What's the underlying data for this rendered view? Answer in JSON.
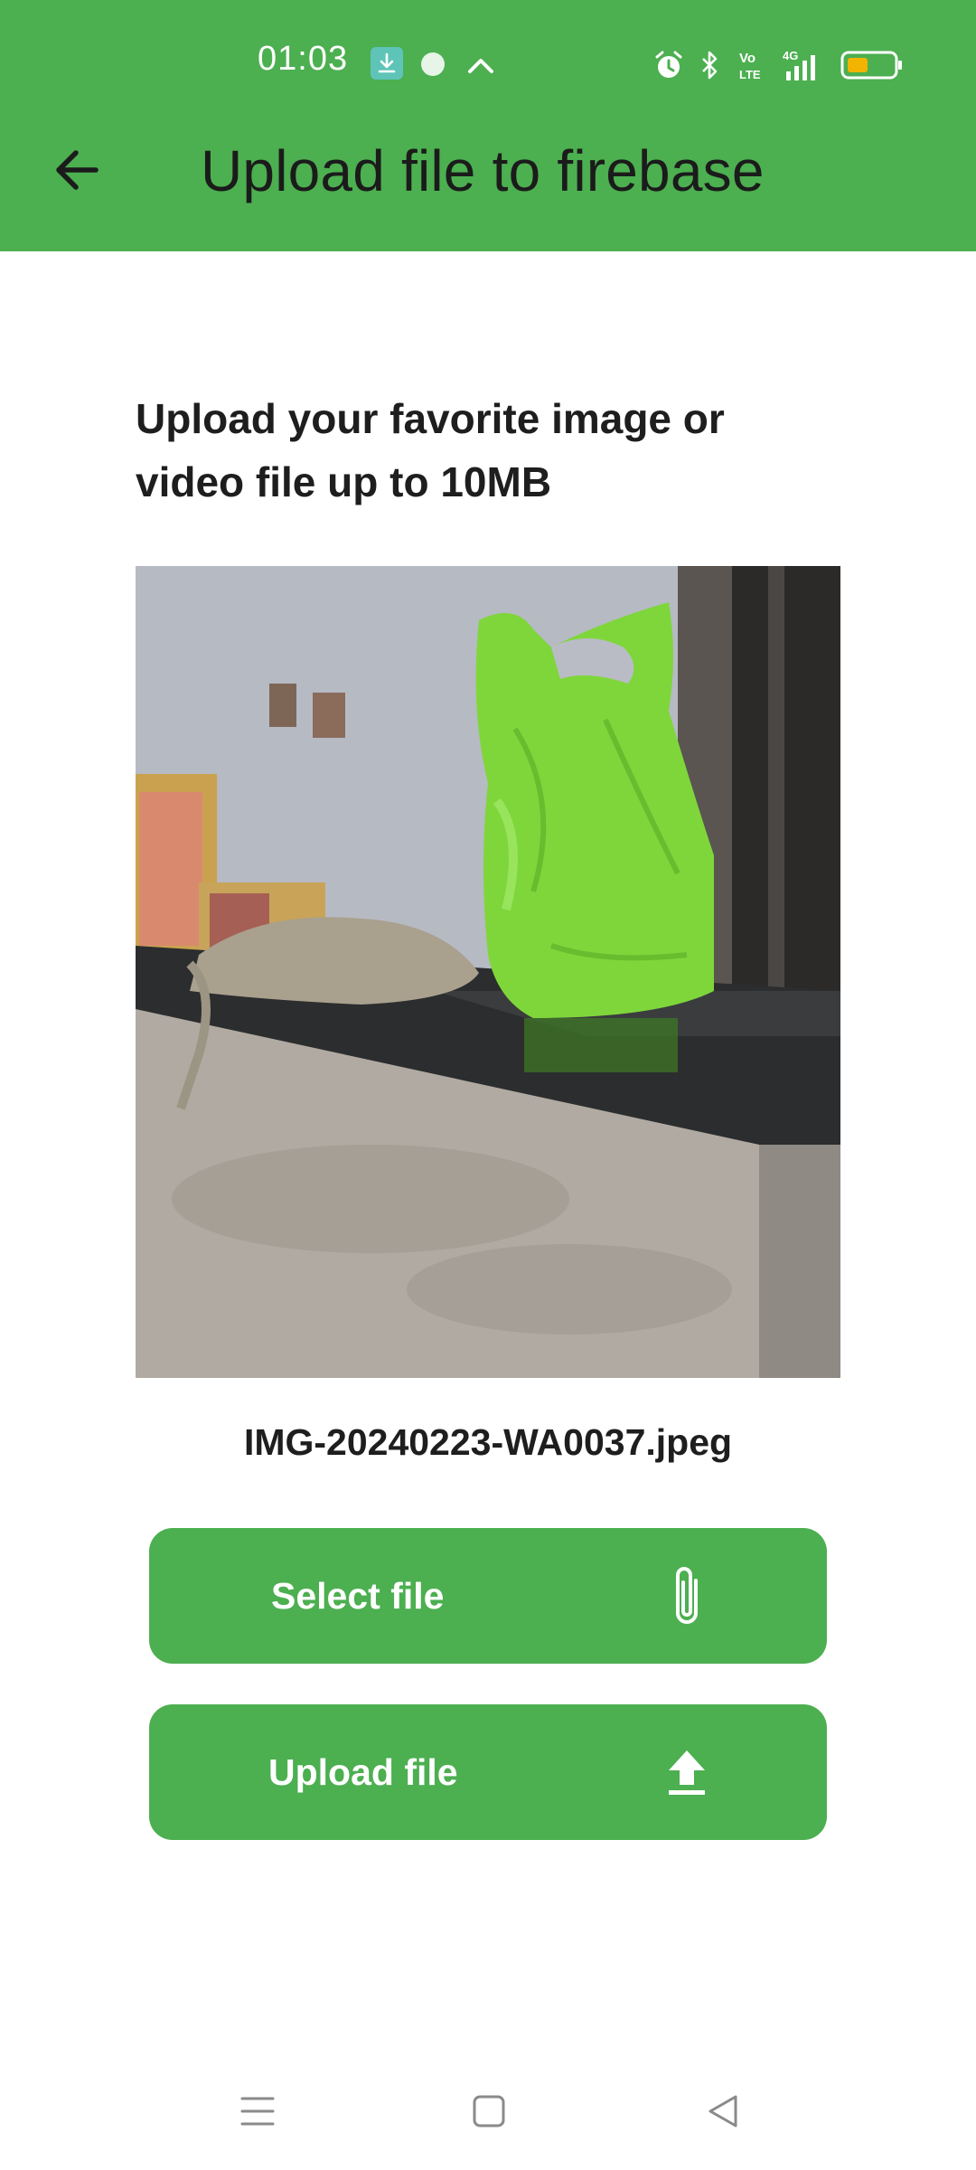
{
  "status_bar": {
    "time": "01:03",
    "icons": [
      "download-icon",
      "app-notification-icon",
      "chevron-up-icon",
      "alarm-icon",
      "bluetooth-icon",
      "volte-icon",
      "signal-4g-icon",
      "battery-icon"
    ],
    "battery_color": "#f2b400"
  },
  "app_bar": {
    "title": "Upload file to firebase",
    "back_icon": "arrow-back-icon",
    "background": "#4caf50"
  },
  "content": {
    "headline": "Upload your favorite image or video file up to 10MB",
    "preview_alt": "selected image preview",
    "file_name": "IMG-20240223-WA0037.jpeg"
  },
  "buttons": {
    "select_label": "Select file",
    "select_icon": "paperclip-icon",
    "upload_label": "Upload file",
    "upload_icon": "upload-icon",
    "color": "#4caf50"
  },
  "nav_bar": {
    "items": [
      "menu-icon",
      "home-icon",
      "back-triangle-icon"
    ]
  }
}
